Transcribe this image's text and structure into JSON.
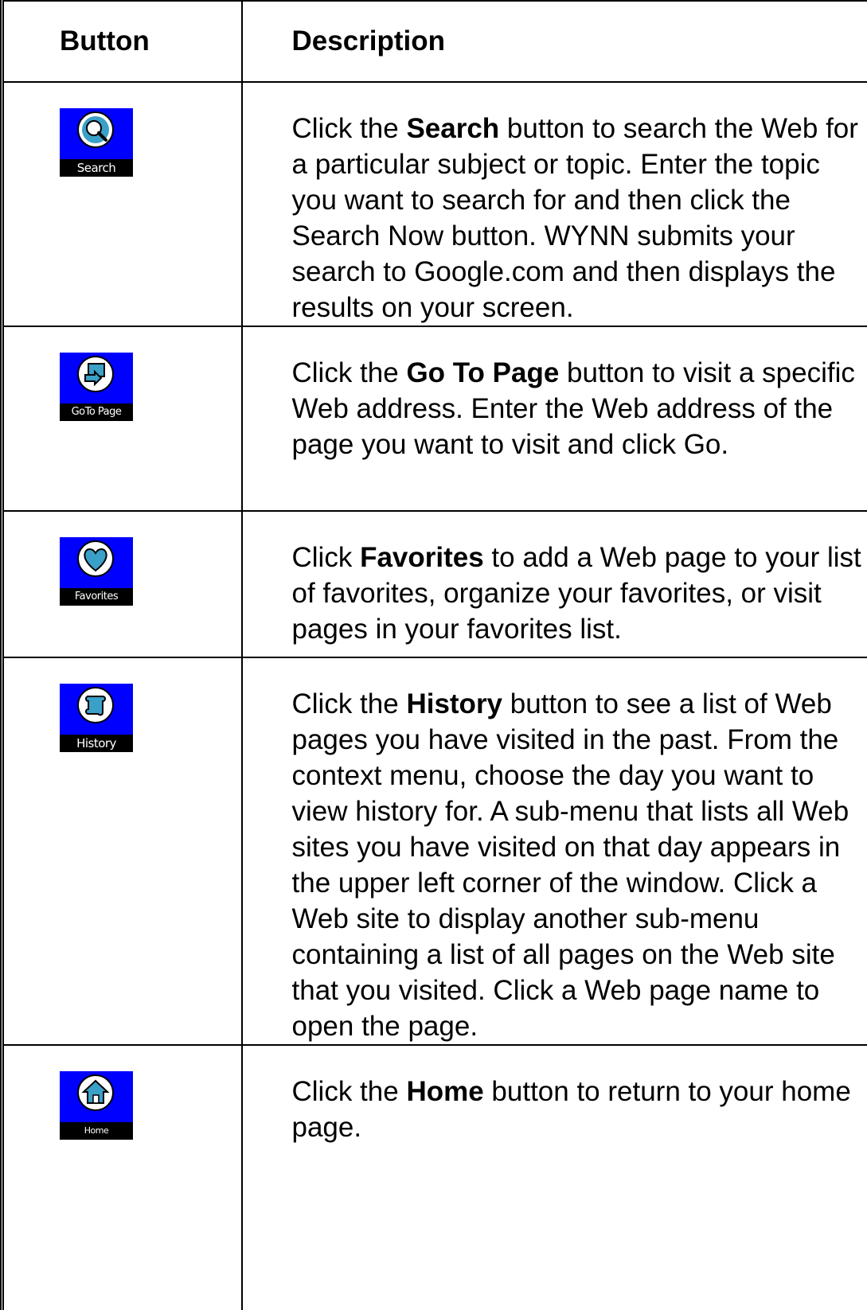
{
  "header": {
    "button_col": "Button",
    "description_col": "Description"
  },
  "rows": [
    {
      "icon": "search-icon",
      "icon_label": "Search",
      "before": "Click the ",
      "bold": "Search",
      "after": " button to search the Web for a particular subject or topic. Enter the topic you want to search for and then click the Search Now button. WYNN submits your search to Google.com and then displays the results on your screen."
    },
    {
      "icon": "go-to-page-icon",
      "icon_label": "GoTo Page",
      "before": "Click the ",
      "bold": "Go To Page",
      "after": " button to visit a specific Web address. Enter the Web address of the page you want to visit and click Go."
    },
    {
      "icon": "favorites-icon",
      "icon_label": "Favorites",
      "before": "Click ",
      "bold": "Favorites",
      "after": " to add a Web page to your list of favorites, organize your favorites, or visit pages in your favorites list."
    },
    {
      "icon": "history-icon",
      "icon_label": "History",
      "before": "Click the ",
      "bold": "History",
      "after": " button to see a list of Web pages you have visited in the past. From the context menu, choose the day you want to view history for. A sub-menu that lists all Web sites you have visited on that day appears in the upper left corner of the window. Click a Web site to display another sub-menu containing a list of all pages on the Web site that you visited. Click a Web page name to open the page."
    },
    {
      "icon": "home-icon",
      "icon_label": "Home",
      "before": "Click the ",
      "bold": "Home",
      "after": " button to return to your home page."
    }
  ],
  "colors": {
    "icon_background": "#0000ff",
    "icon_label_background": "#000000"
  }
}
